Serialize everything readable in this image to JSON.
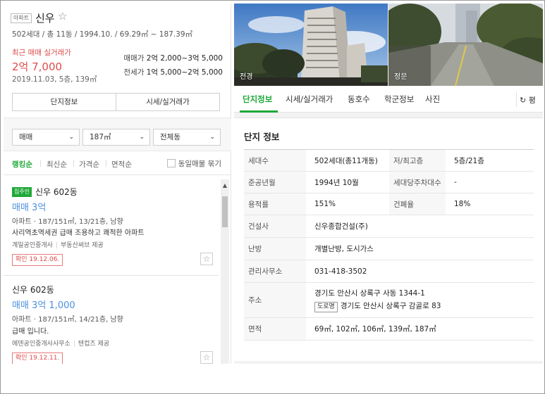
{
  "apartment": {
    "type_badge": "아파트",
    "name": "신우",
    "star": "☆",
    "meta": "502세대 / 총 11동 / 1994.10. / 69.29㎡ ~ 187.39㎡",
    "recent_label": "최근 매매 실거래가",
    "recent_price": "2억 7,000",
    "recent_date": "2019.11.03, 5층, 139㎡",
    "sale_label": "매매가",
    "sale_range": "2억 2,000~3억 5,000",
    "jeonse_label": "전세가",
    "jeonse_range": "1억 5,000~2억 5,000",
    "tab_info": "단지정보",
    "tab_price": "시세/실거래가"
  },
  "filters": {
    "trade_type": "매매",
    "area": "187㎡",
    "dong": "전체동"
  },
  "sort": {
    "options": [
      "랭킹순",
      "최신순",
      "가격순",
      "면적순"
    ],
    "group_same": "동일매물 묶기"
  },
  "listings": [
    {
      "owner_tag": "집주인",
      "title": "신우 602동",
      "price": "매매 3억",
      "spec": "아파트 · 187/151㎡, 13/21층, 남향",
      "desc": "사리역초역세권 급매 조용하고 쾌적한 아파트",
      "agent": "계일공인중개사",
      "provider": "부동산써브 제공",
      "confirm": "확인 19.12.06."
    },
    {
      "title": "신우 602동",
      "price": "매매 3억 1,000",
      "spec": "아파트 · 187/151㎡, 14/21층, 남향",
      "desc": "급매 입니다.",
      "agent": "에덴공인중개사사무소",
      "provider": "텐컵즈 제공",
      "confirm": "확인 19.12.11."
    }
  ],
  "photos": [
    {
      "caption": "전경"
    },
    {
      "caption": "정문"
    }
  ],
  "right_tabs": [
    "단지정보",
    "시세/실거래가",
    "동호수",
    "학군정보",
    "사진"
  ],
  "refresh_label": "평",
  "info": {
    "title": "단지 정보",
    "households_label": "세대수",
    "households": "502세대(총11개동)",
    "floors_label": "저/최고층",
    "floors": "5층/21층",
    "built_label": "준공년월",
    "built": "1994년 10월",
    "parking_label": "세대당주차대수",
    "parking": "-",
    "far_label": "용적률",
    "far": "151%",
    "bcr_label": "건폐율",
    "bcr": "18%",
    "builder_label": "건설사",
    "builder": "신우종합건설(주)",
    "heating_label": "난방",
    "heating": "개별난방, 도시가스",
    "office_label": "관리사무소",
    "office": "031-418-3502",
    "address_label": "주소",
    "address_lot": "경기도 안산시 상록구 사동 1344-1",
    "road_tag": "도로명",
    "address_road": "경기도 안산시 상록구 감골로 83",
    "area_label": "면적",
    "areas": "69㎡, 102㎡, 106㎡, 139㎡, 187㎡"
  },
  "colors": {
    "brand_green": "#1ea838",
    "price_red": "#e04b4b",
    "price_blue": "#4b8fe0"
  }
}
